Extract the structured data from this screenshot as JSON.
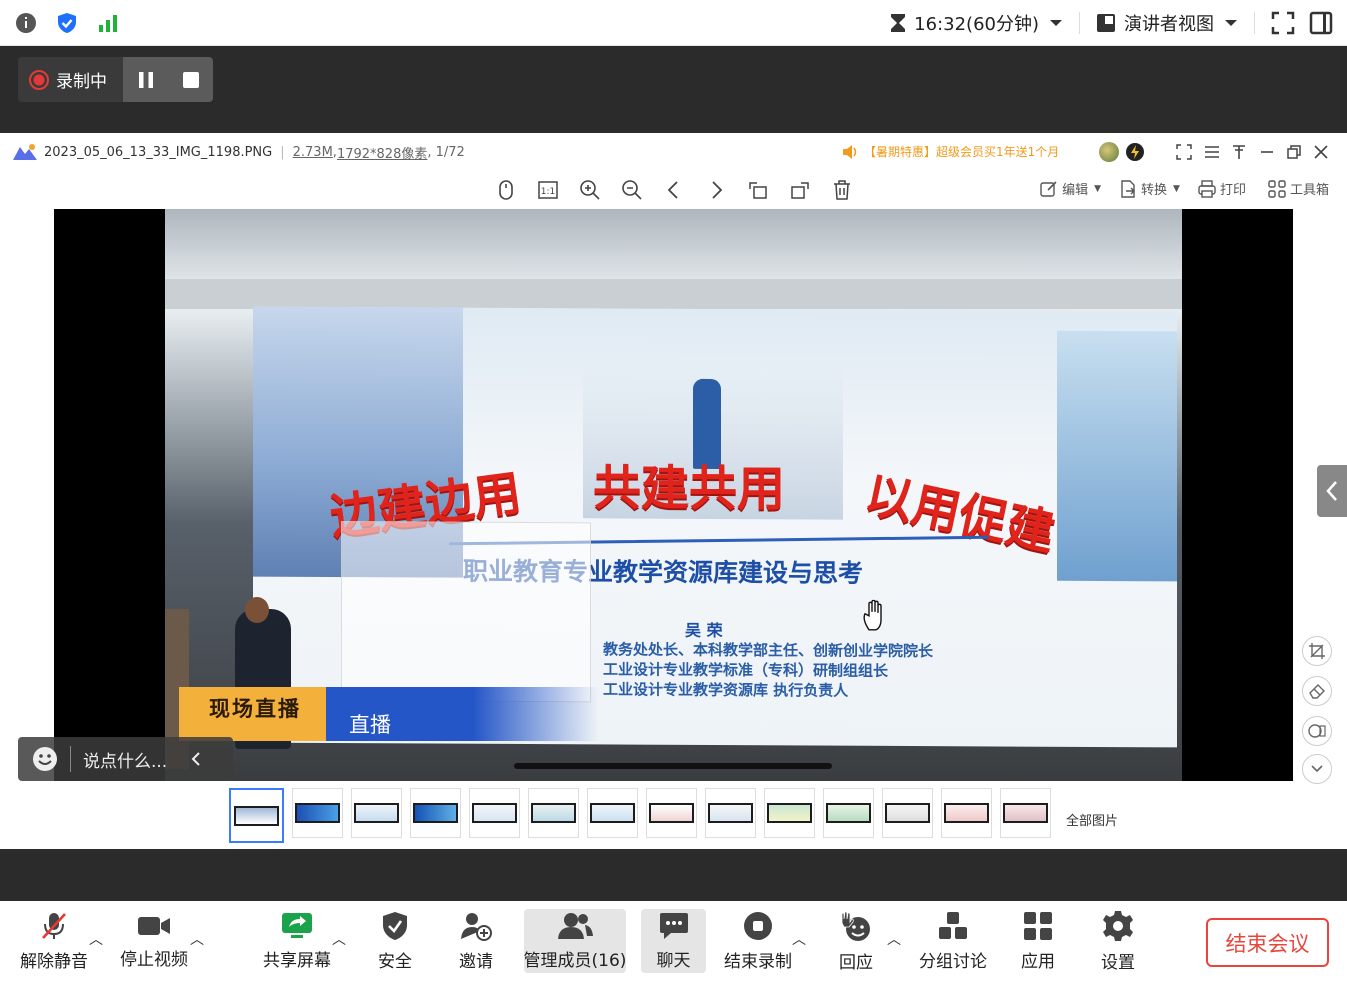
{
  "topbar": {
    "timer": "16:32(60分钟)",
    "view_label": "演讲者视图"
  },
  "recording": {
    "status_label": "录制中"
  },
  "viewer": {
    "filename": "2023_05_06_13_33_IMG_1198.PNG",
    "filesize": "2.73M",
    "resolution": "1792*828像素",
    "page": "1/72",
    "promo": "【暑期特惠】超级会员买1年送1个月",
    "toolbar": {
      "edit_label": "编辑",
      "convert_label": "转换",
      "print_label": "打印",
      "toolbox_label": "工具箱"
    },
    "all_pictures_label": "全部图片"
  },
  "slide": {
    "heading_left": "边建边用",
    "heading_center": "共建共用",
    "heading_right": "以用促建",
    "subtitle": "职业教育专业教学资源库建设与思考",
    "author": "吴  荣",
    "line1": "教务处处长、本科教学部主任、创新创业学院院长",
    "line2": "工业设计专业教学标准（专科）研制组组长",
    "line3": "工业设计专业教学资源库    执行负责人",
    "banner_left": "现场直播",
    "banner_right": "直播"
  },
  "chat": {
    "placeholder": "说点什么..."
  },
  "bottombar": {
    "unmute": "解除静音",
    "stop_video": "停止视频",
    "share_screen": "共享屏幕",
    "security": "安全",
    "invite": "邀请",
    "manage_members": "管理成员(16)",
    "chat": "聊天",
    "end_recording": "结束录制",
    "react": "回应",
    "breakout": "分组讨论",
    "apps": "应用",
    "settings": "设置",
    "end_meeting": "结束会议"
  },
  "colors": {
    "accent_blue": "#1f6fff",
    "record_red": "#e53935",
    "signal_green": "#1fb33a",
    "end_red": "#e8463d",
    "share_green": "#1aa34a"
  }
}
